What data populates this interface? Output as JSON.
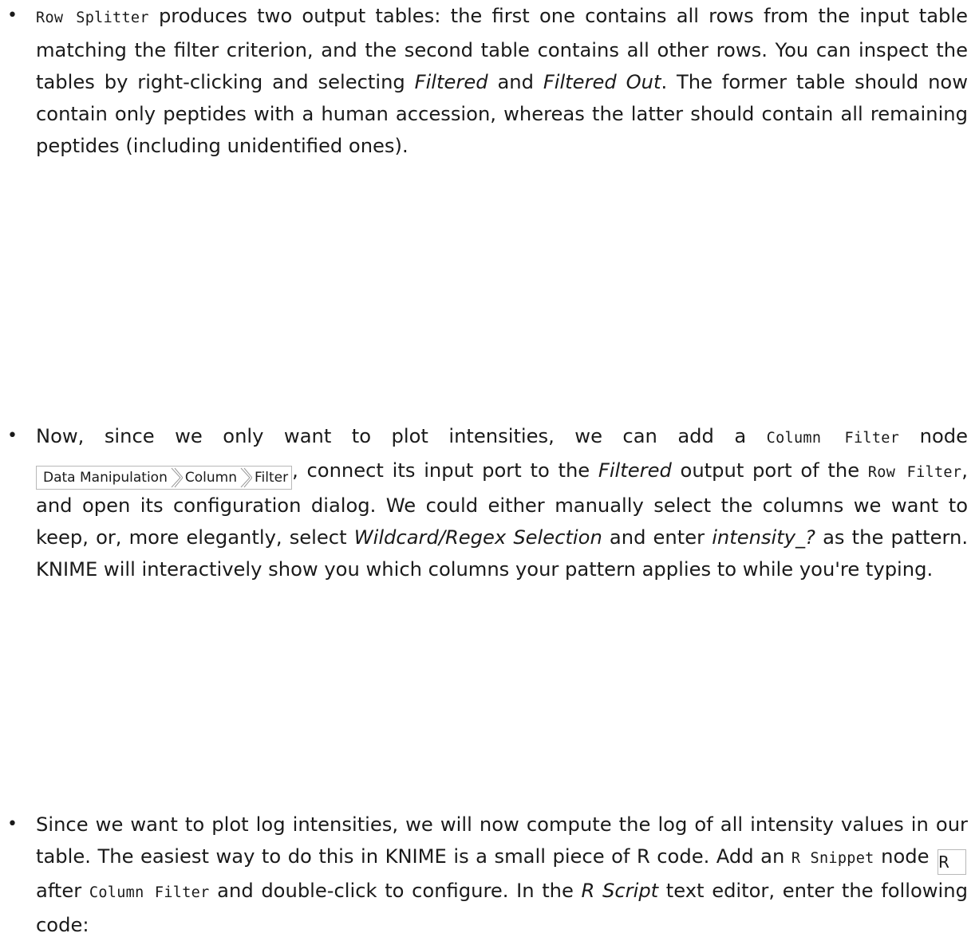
{
  "bullets": [
    {
      "row_splitter": "Row Splitter",
      "t1": " produces two output tables: the first one contains all rows from the input table matching the filter criterion, and the second table contains all other rows. You can inspect the tables by right-clicking and selecting ",
      "filtered": "Filtered",
      "t2": " and ",
      "filtered_out": "Filtered Out",
      "t3": ".  The former table should now contain only peptides with a human accession, whereas the latter should contain all remaining peptides (including unidentified ones)."
    },
    {
      "t1": "Now, since we only want to plot intensities, we can add a ",
      "column_filter": "Column Filter",
      "t2": " node ",
      "menu_path": [
        "Data Manipulation",
        "Column",
        "Filter"
      ],
      "t3": ", connect its input port to the ",
      "filtered": "Filtered",
      "t4": " output port of the ",
      "row_filter": "Row Filter",
      "t5": ", and open its configuration dialog.  We could either manually se­lect the columns we want to keep, or, more elegantly, select ",
      "wildcard": "Wildcard/Regex Selec­tion",
      "t6": " and enter ",
      "pattern": "intensity_?",
      "t7": " as the pattern.  KNIME will interactively show you which columns your pattern applies to while you're typing."
    },
    {
      "t1": "Since we want to plot log intensities, we will now compute the log of all intensity values in our table.  The easiest way to do this in KNIME is a small piece of R code. Add an ",
      "r_snippet": "R Snippet",
      "t2": " node ",
      "r_icon": "R",
      "t3": " after ",
      "column_filter": "Column Filter",
      "t4": " and double-click to configure.  In the ",
      "r_script": "R Script",
      "t5": " text editor, enter the following code:"
    }
  ]
}
